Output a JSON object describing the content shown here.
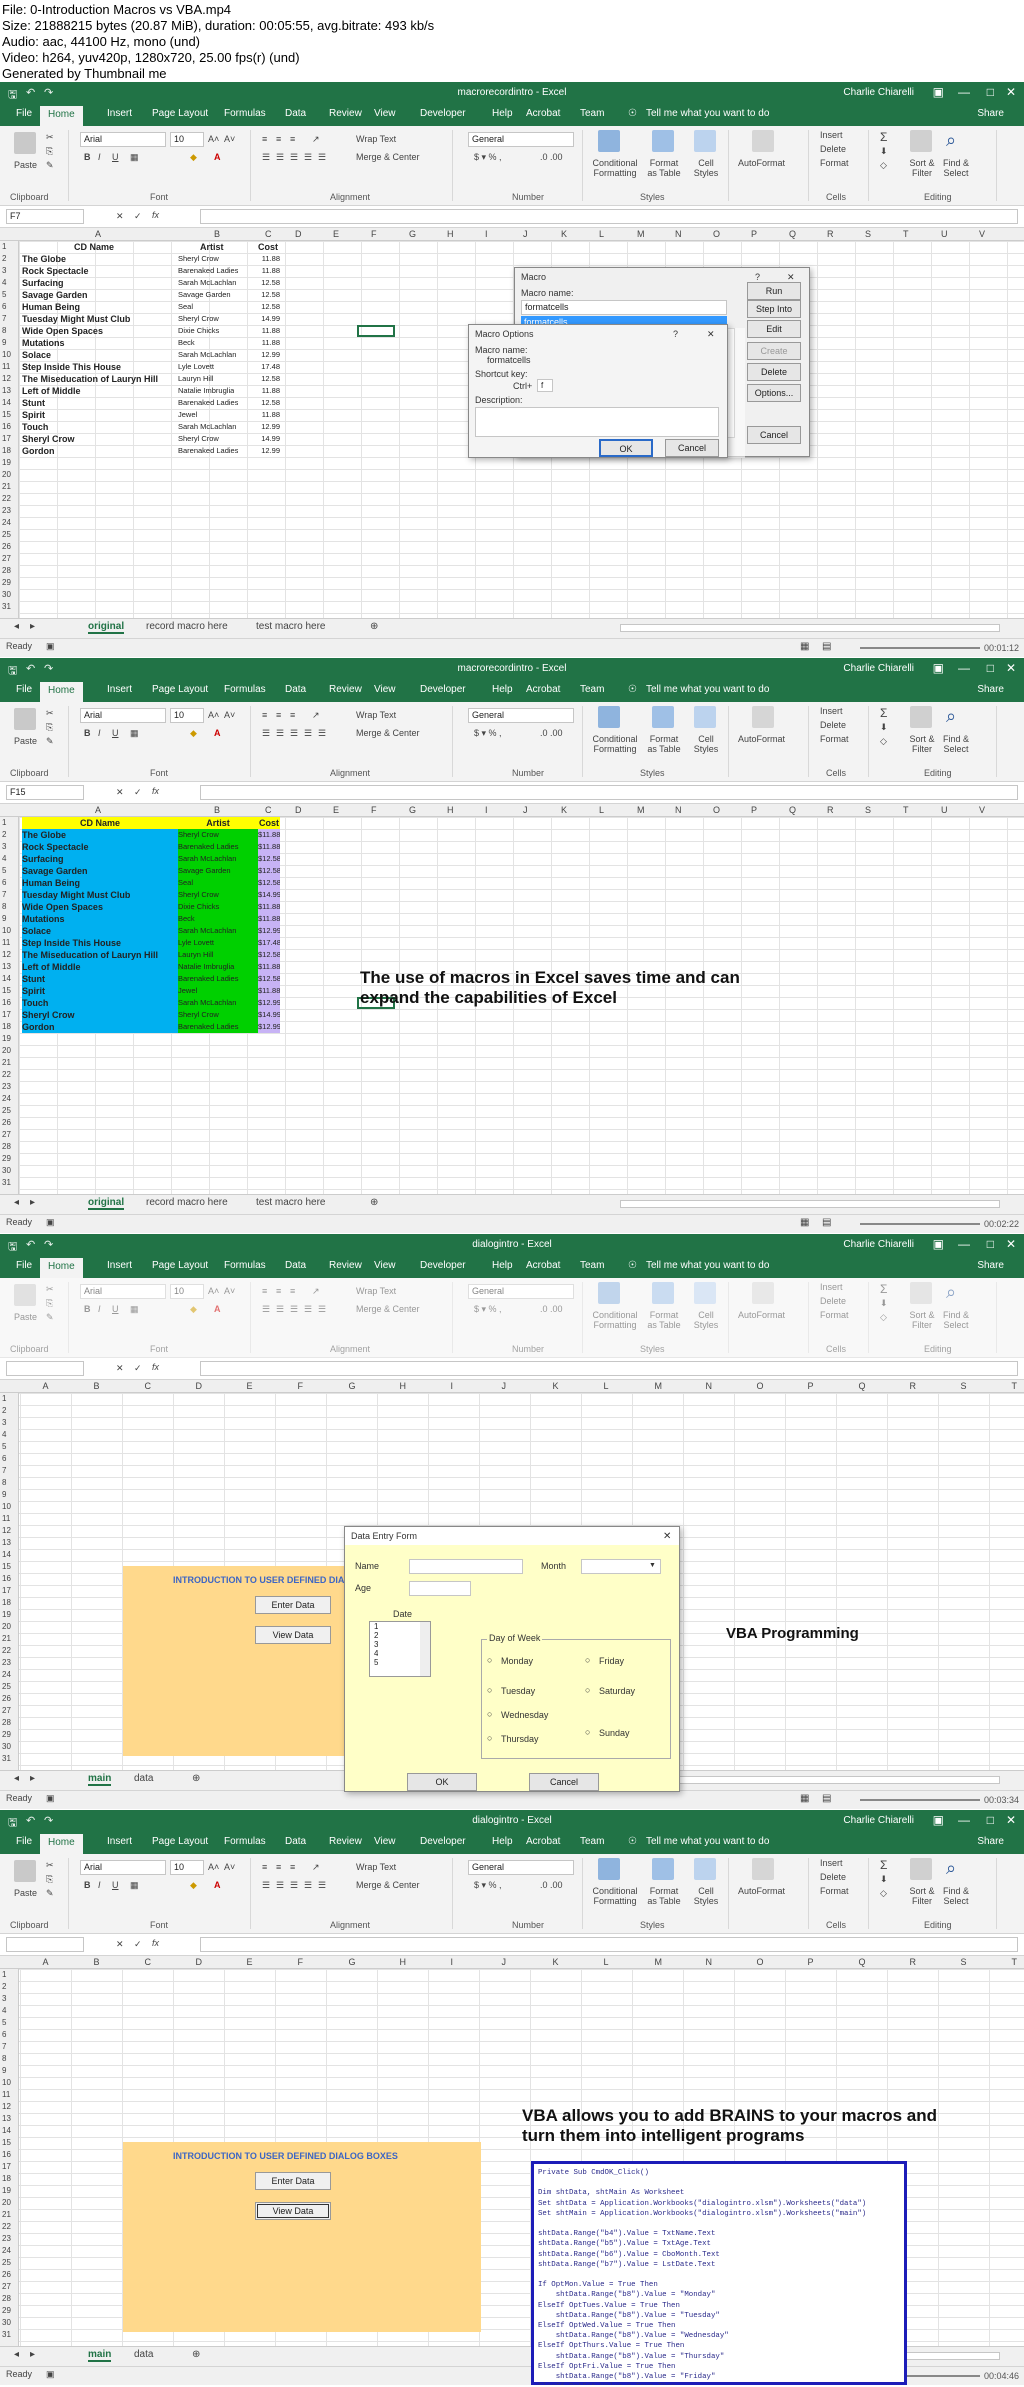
{
  "meta": {
    "l1": "File: 0-Introduction  Macros vs VBA.mp4",
    "l2": "Size: 21888215 bytes (20.87 MiB), duration: 00:05:55, avg.bitrate: 493 kb/s",
    "l3": "Audio: aac, 44100 Hz, mono (und)",
    "l4": "Video: h264, yuv420p, 1280x720, 25.00 fps(r) (und)",
    "l5": "Generated by Thumbnail me"
  },
  "ribbon": {
    "tabs": [
      "File",
      "Home",
      "Insert",
      "Page Layout",
      "Formulas",
      "Data",
      "Review",
      "View",
      "Developer",
      "Help",
      "Acrobat",
      "Team"
    ],
    "tell": "Tell me what you want to do",
    "share": "Share",
    "user": "Charlie Chiarelli",
    "groups": [
      "Clipboard",
      "Font",
      "Alignment",
      "Number",
      "Styles",
      "Cells",
      "Editing"
    ],
    "paste": "Paste",
    "font": "Arial",
    "size": "10",
    "wrap": "Wrap Text",
    "merge": "Merge & Center",
    "numfmt": "General",
    "cond": "Conditional Formatting",
    "fmt_table": "Format as Table",
    "cell_styles": "Cell Styles",
    "autoformat": "AutoFormat",
    "insert": "Insert",
    "delete": "Delete",
    "format": "Format",
    "sort": "Sort & Filter",
    "find": "Find & Select",
    "ready": "Ready"
  },
  "frames": [
    {
      "title": "macrorecordintro - Excel",
      "namebox": "F7",
      "tabs": [
        "original",
        "record macro here",
        "test macro here"
      ],
      "ts": "00:01:12"
    },
    {
      "title": "macrorecordintro - Excel",
      "namebox": "F15",
      "tabs": [
        "original",
        "record macro here",
        "test macro here"
      ],
      "ts": "00:02:22"
    },
    {
      "title": "dialogintro - Excel",
      "namebox": "",
      "tabs": [
        "main",
        "data"
      ],
      "ts": "00:03:34"
    },
    {
      "title": "dialogintro - Excel",
      "namebox": "",
      "tabs": [
        "main",
        "data"
      ],
      "ts": "00:04:46"
    }
  ],
  "cols": [
    "A",
    "B",
    "C",
    "D",
    "E",
    "F",
    "G",
    "H",
    "I",
    "J",
    "K",
    "L",
    "M",
    "N",
    "O",
    "P",
    "Q",
    "R",
    "S",
    "T",
    "U",
    "V"
  ],
  "cols2": [
    "A",
    "B",
    "C",
    "D",
    "E",
    "F",
    "G",
    "H",
    "I",
    "J",
    "K",
    "L",
    "M",
    "N",
    "O",
    "P",
    "Q",
    "R",
    "S",
    "T",
    "U"
  ],
  "table": {
    "headers": [
      "CD Name",
      "Artist",
      "Cost"
    ],
    "rows": [
      [
        "The Globe",
        "Sheryl Crow",
        "11.88"
      ],
      [
        "Rock Spectacle",
        "Barenaked Ladies",
        "11.88"
      ],
      [
        "Surfacing",
        "Sarah McLachlan",
        "12.58"
      ],
      [
        "Savage Garden",
        "Savage Garden",
        "12.58"
      ],
      [
        "Human Being",
        "Seal",
        "12.58"
      ],
      [
        "Tuesday Might Must Club",
        "Sheryl Crow",
        "14.99"
      ],
      [
        "Wide Open Spaces",
        "Dixie Chicks",
        "11.88"
      ],
      [
        "Mutations",
        "Beck",
        "11.88"
      ],
      [
        "Solace",
        "Sarah McLachlan",
        "12.99"
      ],
      [
        "Step Inside This House",
        "Lyle Lovett",
        "17.48"
      ],
      [
        "The Miseducation of Lauryn Hill",
        "Lauryn Hill",
        "12.58"
      ],
      [
        "Left of Middle",
        "Natalie Imbruglia",
        "11.88"
      ],
      [
        "Stunt",
        "Barenaked Ladies",
        "12.58"
      ],
      [
        "Spirit",
        "Jewel",
        "11.88"
      ],
      [
        "Touch",
        "Sarah McLachlan",
        "12.99"
      ],
      [
        "Sheryl Crow",
        "Sheryl Crow",
        "14.99"
      ],
      [
        "Gordon",
        "Barenaked Ladies",
        "12.99"
      ]
    ],
    "costs_fmt": [
      "$11.88",
      "$11.88",
      "$12.58",
      "$12.58",
      "$12.58",
      "$14.99",
      "$11.88",
      "$11.88",
      "$12.99",
      "$17.48",
      "$12.58",
      "$11.88",
      "$12.58",
      "$11.88",
      "$12.99",
      "$14.99",
      "$12.99"
    ]
  },
  "macro": {
    "title": "Macro",
    "label": "Macro name:",
    "value": "formatcells",
    "item": "formatcells",
    "run": "Run",
    "step": "Step Into",
    "edit": "Edit",
    "create": "Create",
    "delete": "Delete",
    "options": "Options...",
    "cancel": "Cancel",
    "help": "?"
  },
  "mopts": {
    "title": "Macro Options",
    "name_label": "Macro name:",
    "name": "formatcells",
    "shortcut_label": "Shortcut key:",
    "ctrl": "Ctrl+",
    "key": "f",
    "desc_label": "Description:",
    "ok": "OK",
    "cancel": "Cancel",
    "help": "?"
  },
  "note2": "The use of macros in Excel saves time and can expand the capabilities of Excel",
  "dialog_panel": {
    "title": "INTRODUCTION TO USER DEFINED DIALOG BOXES",
    "enter": "Enter Data",
    "view": "View Data"
  },
  "form": {
    "title": "Data Entry Form",
    "name": "Name",
    "month": "Month",
    "age": "Age",
    "date": "Date",
    "dow": "Day of Week",
    "list": [
      "1",
      "2",
      "3",
      "4",
      "5"
    ],
    "days": [
      "Monday",
      "Friday",
      "Tuesday",
      "Saturday",
      "Wednesday",
      "Thursday",
      "Sunday"
    ],
    "ok": "OK",
    "cancel": "Cancel"
  },
  "vba_title": "VBA Programming",
  "note4": "VBA allows you to add BRAINS to your macros and turn them into intelligent programs",
  "code": "Private Sub CmdOK_Click()\n\nDim shtData, shtMain As Worksheet\nSet shtData = Application.Workbooks(\"dialogintro.xlsm\").Worksheets(\"data\")\nSet shtMain = Application.Workbooks(\"dialogintro.xlsm\").Worksheets(\"main\")\n\nshtData.Range(\"b4\").Value = TxtName.Text\nshtData.Range(\"b5\").Value = TxtAge.Text\nshtData.Range(\"b6\").Value = CboMonth.Text\nshtData.Range(\"b7\").Value = LstDate.Text\n\nIf OptMon.Value = True Then\n    shtData.Range(\"b8\").Value = \"Monday\"\nElseIf OptTues.Value = True Then\n    shtData.Range(\"b8\").Value = \"Tuesday\"\nElseIf OptWed.Value = True Then\n    shtData.Range(\"b8\").Value = \"Wednesday\"\nElseIf OptThurs.Value = True Then\n    shtData.Range(\"b8\").Value = \"Thursday\"\nElseIf OptFri.Value = True Then\n    shtData.Range(\"b8\").Value = \"Friday\"\nElseIf OptSat.Value = True Then\n    shtData.Range(\"b8\").Value = \"Saturday\"\nElse\n    shtData.Range(\"b8\").Value = \"Sunday\"\nEnd If\n\nfrmDataEntry.Hide\n\nshtMain.Activate\n\nEnd Sub",
  "colors": {
    "excel_green": "#217346",
    "yellow": "#ffff00",
    "cyan": "#00b0f0",
    "green": "#00d000",
    "lilac": "#c7b3f5",
    "panel": "#ffd98c",
    "form": "#ffffc8"
  }
}
